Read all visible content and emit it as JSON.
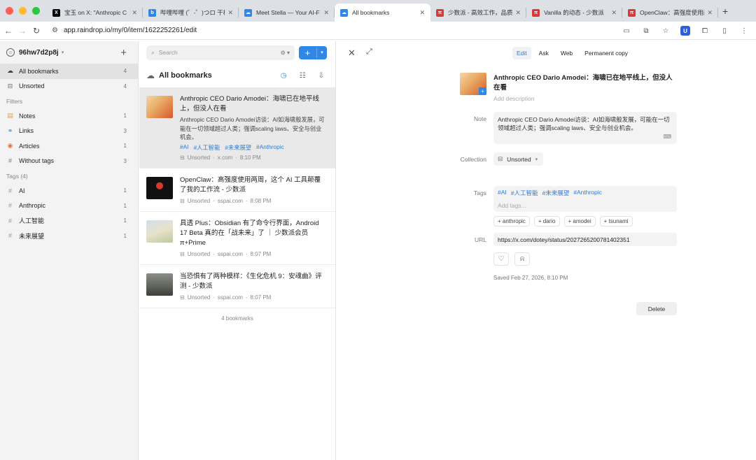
{
  "browser": {
    "tabs": [
      {
        "title": "宝玉 on X: \"Anthropic C",
        "favicon_color": "#000000",
        "favicon_glyph": "X",
        "active": false
      },
      {
        "title": "哔哩哔哩 (゜-゜)つロ 干杯",
        "favicon_color": "#2f88e6",
        "favicon_glyph": "b",
        "active": false
      },
      {
        "title": "Meet Stella — Your AI-F",
        "favicon_color": "#2f88e6",
        "favicon_glyph": "☁",
        "active": false
      },
      {
        "title": "All bookmarks",
        "favicon_color": "#2f88e6",
        "favicon_glyph": "☁",
        "active": true
      },
      {
        "title": "少数派 - 高效工作，品质",
        "favicon_color": "#d63a3a",
        "favicon_glyph": "π",
        "active": false
      },
      {
        "title": "Vanilla 的动态 - 少数派",
        "favicon_color": "#d63a3a",
        "favicon_glyph": "π",
        "active": false
      },
      {
        "title": "OpenClaw：高强度使用两",
        "favicon_color": "#d63a3a",
        "favicon_glyph": "π",
        "active": false
      }
    ],
    "url": "app.raindrop.io/my/0/item/1622252261/edit"
  },
  "sidebar": {
    "account": "96hw7d2p8j",
    "collections": [
      {
        "label": "All bookmarks",
        "count": "4",
        "icon": "cloud-icon",
        "selected": true
      },
      {
        "label": "Unsorted",
        "count": "4",
        "icon": "inbox-icon",
        "selected": false
      }
    ],
    "filters_heading": "Filters",
    "filters": [
      {
        "label": "Notes",
        "count": "1",
        "icon": "note-icon",
        "color": "#e8a33a"
      },
      {
        "label": "Links",
        "count": "3",
        "icon": "link-icon",
        "color": "#3a8fe8"
      },
      {
        "label": "Articles",
        "count": "1",
        "icon": "article-icon",
        "color": "#e8703a"
      },
      {
        "label": "Without tags",
        "count": "3",
        "icon": "hash-icon",
        "color": "#777777"
      }
    ],
    "tags_heading": "Tags (4)",
    "tags": [
      {
        "label": "AI",
        "count": "1"
      },
      {
        "label": "Anthropic",
        "count": "1"
      },
      {
        "label": "人工智能",
        "count": "1"
      },
      {
        "label": "未来展望",
        "count": "1"
      }
    ]
  },
  "list": {
    "search_placeholder": "Search",
    "heading": "All bookmarks",
    "items": [
      {
        "title": "Anthropic CEO Dario Amodei：海啸已在地平线上，但没人在看",
        "excerpt": "Anthropic CEO Dario Amodei访谈：AI如海啸般发展，可能在一切领域超过人类；强调scaling laws、安全与创业机会。",
        "tags": [
          "#AI",
          "#人工智能",
          "#未来展望",
          "#Anthropic"
        ],
        "collection": "Unsorted",
        "domain": "x.com",
        "time": "8:10 PM"
      },
      {
        "title": "OpenClaw：高强度使用两周，这个 AI 工具颠覆了我的工作流 - 少数派",
        "excerpt": "",
        "tags": [],
        "collection": "Unsorted",
        "domain": "sspai.com",
        "time": "8:08 PM"
      },
      {
        "title": "具透 Plus：Obsidian 有了命令行界面，Android 17 Beta 真的在「战未来」了 ｜ 少数派会员 π+Prime",
        "excerpt": "",
        "tags": [],
        "collection": "Unsorted",
        "domain": "sspai.com",
        "time": "8:07 PM"
      },
      {
        "title": "当恐惧有了两种模样：《生化危机 9：安魂曲》评测 - 少数派",
        "excerpt": "",
        "tags": [],
        "collection": "Unsorted",
        "domain": "sspai.com",
        "time": "8:07 PM"
      }
    ],
    "footer": "4 bookmarks"
  },
  "detail": {
    "tabs": [
      "Edit",
      "Ask",
      "Web",
      "Permanent copy"
    ],
    "title": "Anthropic CEO Dario Amodei：海啸已在地平线上，但没人在看",
    "description_placeholder": "Add description",
    "labels": {
      "note": "Note",
      "collection": "Collection",
      "tags": "Tags",
      "url": "URL"
    },
    "note": "Anthropic CEO Dario Amodei访谈：AI如海啸般发展，可能在一切领域超过人类；强调scaling laws、安全与创业机会。",
    "collection": "Unsorted",
    "tags": [
      "#AI",
      "#人工智能",
      "#未来展望",
      "#Anthropic"
    ],
    "tag_placeholder": "Add tags...",
    "suggested_tags": [
      "+ anthropic",
      "+ dario",
      "+ amodei",
      "+ tsunami"
    ],
    "url": "https://x.com/dotey/status/2027265200781402351",
    "saved": "Saved Feb 27, 2026, 8:10 PM",
    "delete_label": "Delete"
  }
}
